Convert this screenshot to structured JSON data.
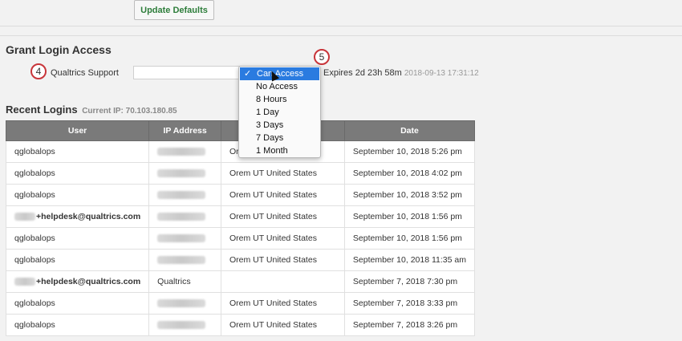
{
  "top": {
    "update_defaults_label": "Update Defaults"
  },
  "grant": {
    "title": "Grant Login Access",
    "callout_left": "4",
    "callout_right": "5",
    "support_label": "Qualtrics Support",
    "expires_text": "Expires 2d 23h 58m",
    "expires_timestamp": "2018-09-13 17:31:12",
    "dropdown": {
      "check": "✓",
      "options": [
        "Can Access",
        "No Access",
        "8 Hours",
        "1 Day",
        "3 Days",
        "7 Days",
        "1 Month"
      ],
      "selected": "Can Access"
    }
  },
  "recent": {
    "title": "Recent Logins",
    "current_ip_label": "Current IP: 70.103.180.85",
    "columns": [
      "User",
      "IP Address",
      "",
      "Date"
    ],
    "rows": [
      {
        "user": "qglobalops",
        "location": "Orem UT United States",
        "date": "September 10, 2018 5:26 pm"
      },
      {
        "user": "qglobalops",
        "location": "Orem UT United States",
        "date": "September 10, 2018 4:02 pm"
      },
      {
        "user": "qglobalops",
        "location": "Orem UT United States",
        "date": "September 10, 2018 3:52 pm"
      },
      {
        "user": "+helpdesk@qualtrics.com",
        "location": "Orem UT United States",
        "date": "September 10, 2018 1:56 pm"
      },
      {
        "user": "qglobalops",
        "location": "Orem UT United States",
        "date": "September 10, 2018 1:56 pm"
      },
      {
        "user": "qglobalops",
        "location": "Orem UT United States",
        "date": "September 10, 2018 11:35 am"
      },
      {
        "user": "+helpdesk@qualtrics.com",
        "location": "Qualtrics",
        "date": "September 7, 2018 7:30 pm"
      },
      {
        "user": "qglobalops",
        "location": "Orem UT United States",
        "date": "September 7, 2018 3:33 pm"
      },
      {
        "user": "qglobalops",
        "location": "Orem UT United States",
        "date": "September 7, 2018 3:26 pm"
      }
    ]
  },
  "colors": {
    "accent_green": "#2d7d3a",
    "header_gray": "#7a7a7a",
    "callout_red": "#c8353a",
    "selection_blue": "#2a7be0"
  }
}
